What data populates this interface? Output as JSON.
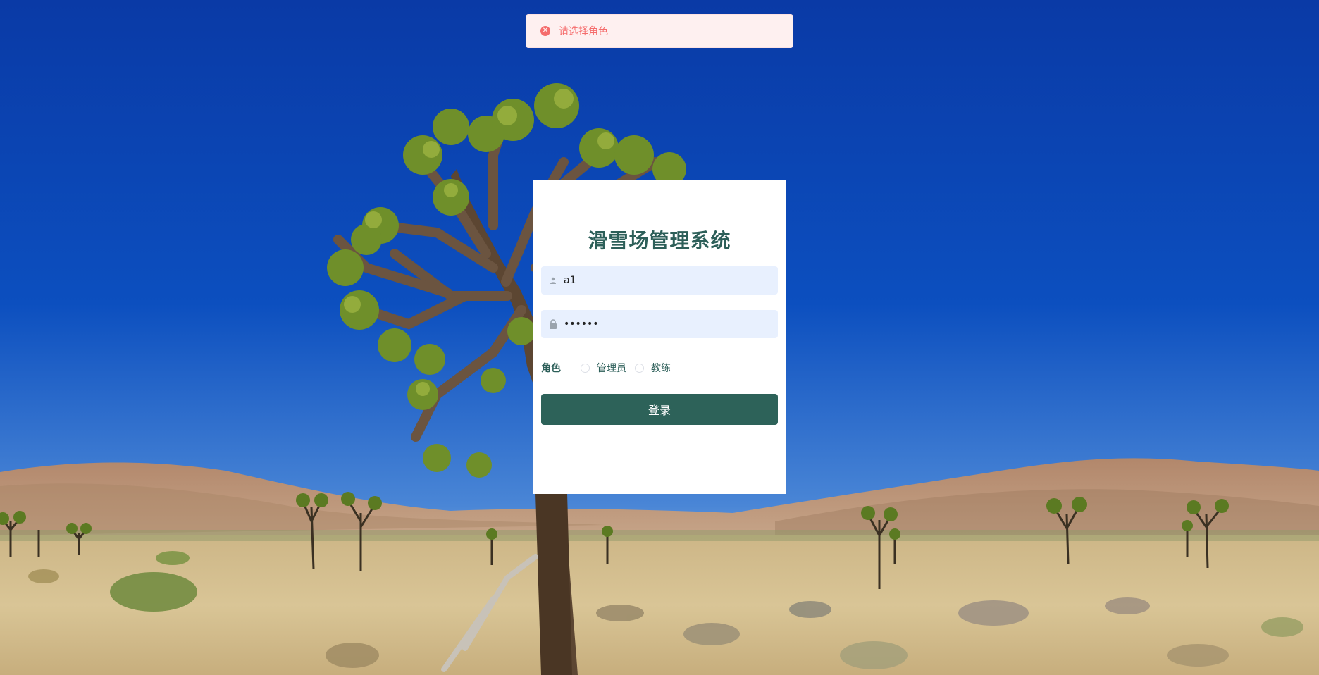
{
  "toast": {
    "icon": "error-circle-icon",
    "message": "请选择角色",
    "color": "#f56c6c"
  },
  "login": {
    "title": "滑雪场管理系统",
    "username": {
      "icon": "user-icon",
      "value": "a1"
    },
    "password": {
      "icon": "lock-icon",
      "value": "••••••"
    },
    "role_label": "角色",
    "roles": [
      {
        "label": "管理员",
        "selected": false
      },
      {
        "label": "教练",
        "selected": false
      }
    ],
    "submit_label": "登录"
  },
  "colors": {
    "accent": "#2d6259",
    "title": "#2d5f59",
    "input_bg": "#e8f0fe"
  }
}
